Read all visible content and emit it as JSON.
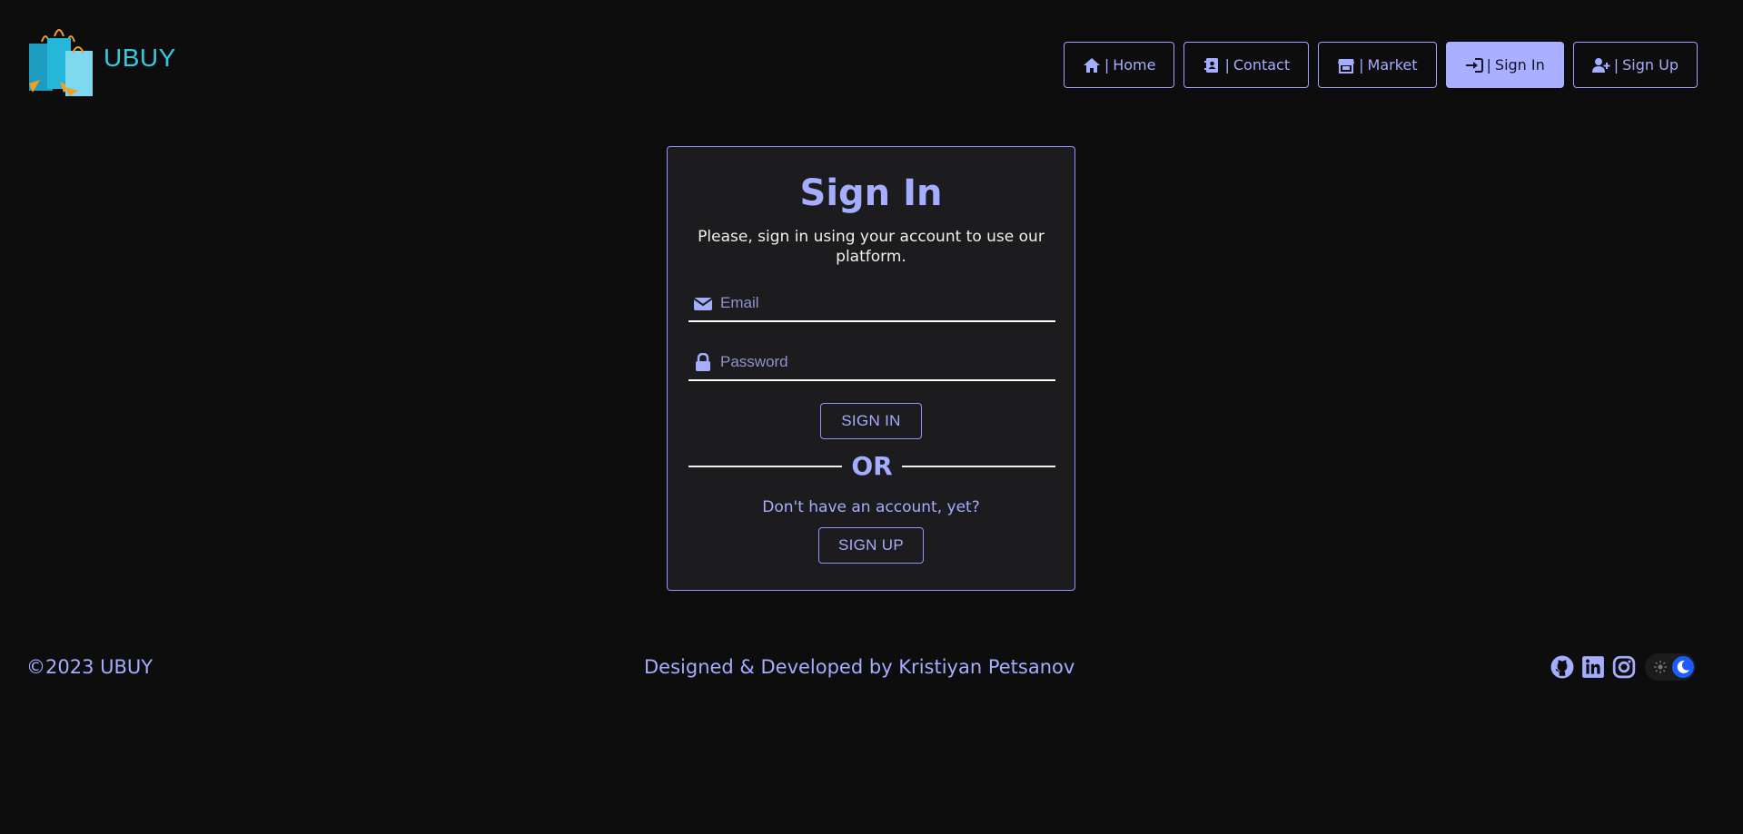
{
  "brand": {
    "name": "UBUY"
  },
  "nav": {
    "items": [
      {
        "label": "Home",
        "icon": "home-icon"
      },
      {
        "label": "Contact",
        "icon": "contact-book-icon"
      },
      {
        "label": "Market",
        "icon": "store-icon"
      },
      {
        "label": "Sign In",
        "icon": "sign-in-icon",
        "active": true
      },
      {
        "label": "Sign Up",
        "icon": "user-plus-icon"
      }
    ],
    "separator": "|"
  },
  "signin": {
    "title": "Sign In",
    "subtitle": "Please, sign in using your account to use our platform.",
    "email_placeholder": "Email",
    "password_placeholder": "Password",
    "signin_button": "SIGN IN",
    "or": "OR",
    "no_account": "Don't have an account, yet?",
    "signup_button": "SIGN UP"
  },
  "footer": {
    "copyright": "©2023 UBUY",
    "credit": "Designed & Developed by Kristiyan Petsanov",
    "socials": [
      "github-icon",
      "linkedin-icon",
      "instagram-icon"
    ]
  },
  "colors": {
    "background": "#0d0d0e",
    "card": "#1c1c1e",
    "accent": "#a5adff",
    "toggle_knob": "#1d5bff",
    "logo_text": "#38c6e0"
  }
}
